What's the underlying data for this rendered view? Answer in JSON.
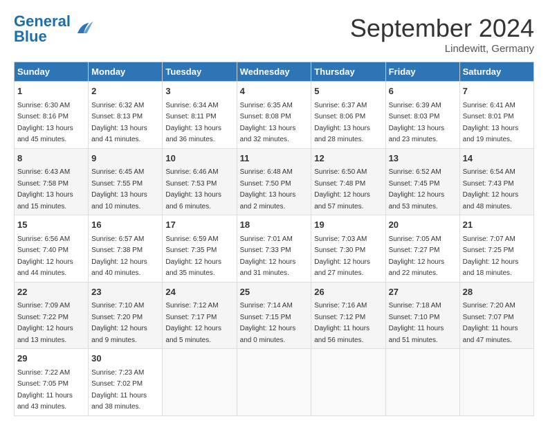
{
  "header": {
    "logo_general": "General",
    "logo_blue": "Blue",
    "month_title": "September 2024",
    "location": "Lindewitt, Germany"
  },
  "days_of_week": [
    "Sunday",
    "Monday",
    "Tuesday",
    "Wednesday",
    "Thursday",
    "Friday",
    "Saturday"
  ],
  "weeks": [
    [
      {
        "day": "1",
        "sunrise": "6:30 AM",
        "sunset": "8:16 PM",
        "daylight": "13 hours and 45 minutes."
      },
      {
        "day": "2",
        "sunrise": "6:32 AM",
        "sunset": "8:13 PM",
        "daylight": "13 hours and 41 minutes."
      },
      {
        "day": "3",
        "sunrise": "6:34 AM",
        "sunset": "8:11 PM",
        "daylight": "13 hours and 36 minutes."
      },
      {
        "day": "4",
        "sunrise": "6:35 AM",
        "sunset": "8:08 PM",
        "daylight": "13 hours and 32 minutes."
      },
      {
        "day": "5",
        "sunrise": "6:37 AM",
        "sunset": "8:06 PM",
        "daylight": "13 hours and 28 minutes."
      },
      {
        "day": "6",
        "sunrise": "6:39 AM",
        "sunset": "8:03 PM",
        "daylight": "13 hours and 23 minutes."
      },
      {
        "day": "7",
        "sunrise": "6:41 AM",
        "sunset": "8:01 PM",
        "daylight": "13 hours and 19 minutes."
      }
    ],
    [
      {
        "day": "8",
        "sunrise": "6:43 AM",
        "sunset": "7:58 PM",
        "daylight": "13 hours and 15 minutes."
      },
      {
        "day": "9",
        "sunrise": "6:45 AM",
        "sunset": "7:55 PM",
        "daylight": "13 hours and 10 minutes."
      },
      {
        "day": "10",
        "sunrise": "6:46 AM",
        "sunset": "7:53 PM",
        "daylight": "13 hours and 6 minutes."
      },
      {
        "day": "11",
        "sunrise": "6:48 AM",
        "sunset": "7:50 PM",
        "daylight": "13 hours and 2 minutes."
      },
      {
        "day": "12",
        "sunrise": "6:50 AM",
        "sunset": "7:48 PM",
        "daylight": "12 hours and 57 minutes."
      },
      {
        "day": "13",
        "sunrise": "6:52 AM",
        "sunset": "7:45 PM",
        "daylight": "12 hours and 53 minutes."
      },
      {
        "day": "14",
        "sunrise": "6:54 AM",
        "sunset": "7:43 PM",
        "daylight": "12 hours and 48 minutes."
      }
    ],
    [
      {
        "day": "15",
        "sunrise": "6:56 AM",
        "sunset": "7:40 PM",
        "daylight": "12 hours and 44 minutes."
      },
      {
        "day": "16",
        "sunrise": "6:57 AM",
        "sunset": "7:38 PM",
        "daylight": "12 hours and 40 minutes."
      },
      {
        "day": "17",
        "sunrise": "6:59 AM",
        "sunset": "7:35 PM",
        "daylight": "12 hours and 35 minutes."
      },
      {
        "day": "18",
        "sunrise": "7:01 AM",
        "sunset": "7:33 PM",
        "daylight": "12 hours and 31 minutes."
      },
      {
        "day": "19",
        "sunrise": "7:03 AM",
        "sunset": "7:30 PM",
        "daylight": "12 hours and 27 minutes."
      },
      {
        "day": "20",
        "sunrise": "7:05 AM",
        "sunset": "7:27 PM",
        "daylight": "12 hours and 22 minutes."
      },
      {
        "day": "21",
        "sunrise": "7:07 AM",
        "sunset": "7:25 PM",
        "daylight": "12 hours and 18 minutes."
      }
    ],
    [
      {
        "day": "22",
        "sunrise": "7:09 AM",
        "sunset": "7:22 PM",
        "daylight": "12 hours and 13 minutes."
      },
      {
        "day": "23",
        "sunrise": "7:10 AM",
        "sunset": "7:20 PM",
        "daylight": "12 hours and 9 minutes."
      },
      {
        "day": "24",
        "sunrise": "7:12 AM",
        "sunset": "7:17 PM",
        "daylight": "12 hours and 5 minutes."
      },
      {
        "day": "25",
        "sunrise": "7:14 AM",
        "sunset": "7:15 PM",
        "daylight": "12 hours and 0 minutes."
      },
      {
        "day": "26",
        "sunrise": "7:16 AM",
        "sunset": "7:12 PM",
        "daylight": "11 hours and 56 minutes."
      },
      {
        "day": "27",
        "sunrise": "7:18 AM",
        "sunset": "7:10 PM",
        "daylight": "11 hours and 51 minutes."
      },
      {
        "day": "28",
        "sunrise": "7:20 AM",
        "sunset": "7:07 PM",
        "daylight": "11 hours and 47 minutes."
      }
    ],
    [
      {
        "day": "29",
        "sunrise": "7:22 AM",
        "sunset": "7:05 PM",
        "daylight": "11 hours and 43 minutes."
      },
      {
        "day": "30",
        "sunrise": "7:23 AM",
        "sunset": "7:02 PM",
        "daylight": "11 hours and 38 minutes."
      },
      null,
      null,
      null,
      null,
      null
    ]
  ]
}
